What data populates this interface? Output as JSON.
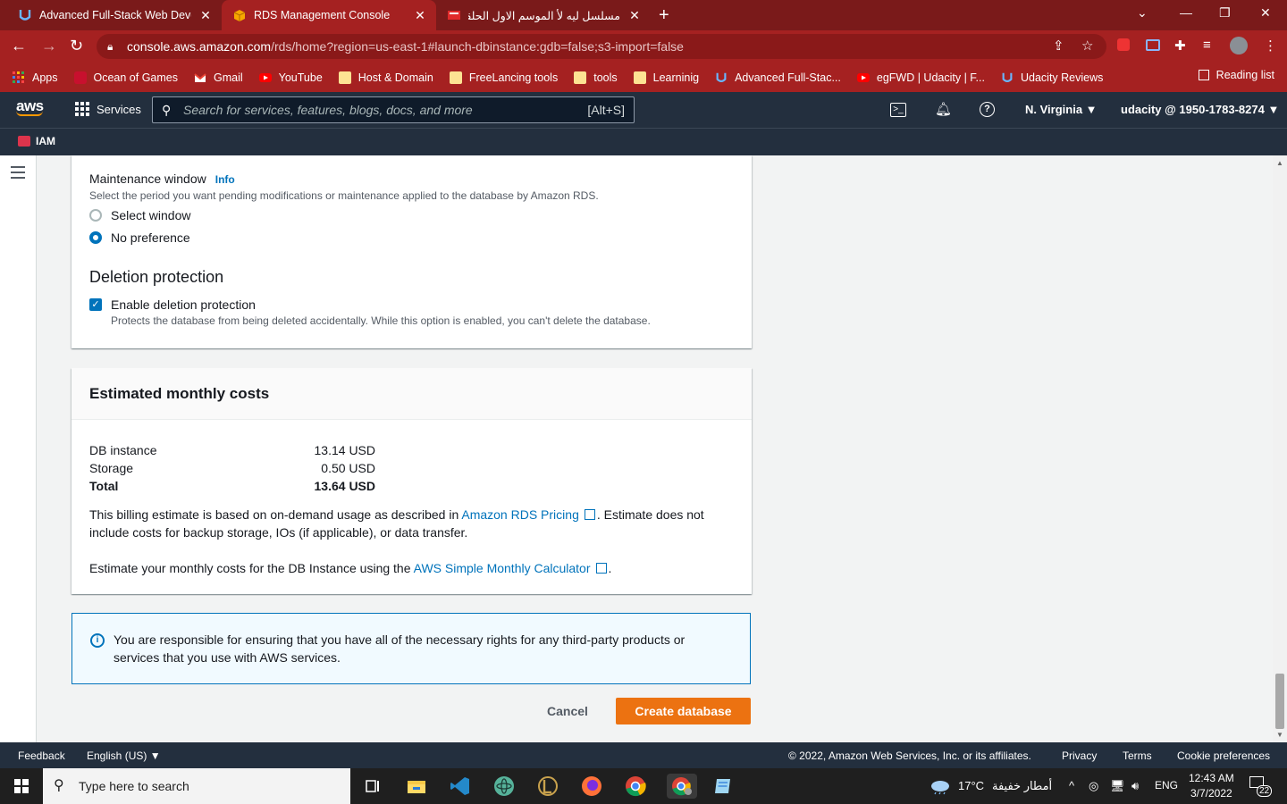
{
  "browser": {
    "tabs": [
      {
        "title": "Advanced Full-Stack Web Develo",
        "close": "✕"
      },
      {
        "title": "RDS Management Console",
        "close": "✕"
      },
      {
        "title": "مسلسل ليه لأ الموسم الاول الحلقة",
        "close": "✕"
      }
    ],
    "url_domain": "console.aws.amazon.com",
    "url_rest": "/rds/home?region=us-east-1#launch-dbinstance:gdb=false;s3-import=false",
    "bookmarks": [
      "Apps",
      "Ocean of Games",
      "Gmail",
      "YouTube",
      "Host & Domain",
      "FreeLancing tools",
      "tools",
      "Learninig",
      "Advanced Full-Stac...",
      "egFWD | Udacity | F...",
      "Udacity Reviews"
    ],
    "reading_list": "Reading list"
  },
  "aws_header": {
    "logo": "aws",
    "services": "Services",
    "search_placeholder": "Search for services, features, blogs, docs, and more",
    "search_shortcut": "[Alt+S]",
    "region": "N. Virginia ▼",
    "account": "udacity @ 1950-1783-8274 ▼",
    "favorite": "IAM"
  },
  "maintenance": {
    "label": "Maintenance window",
    "info": "Info",
    "description": "Select the period you want pending modifications or maintenance applied to the database by Amazon RDS.",
    "options": [
      "Select window",
      "No preference"
    ],
    "selected": "No preference"
  },
  "deletion": {
    "title": "Deletion protection",
    "checkbox_label": "Enable deletion protection",
    "checked": true,
    "description": "Protects the database from being deleted accidentally. While this option is enabled, you can't delete the database."
  },
  "costs": {
    "title": "Estimated monthly costs",
    "rows": [
      {
        "label": "DB instance",
        "value": "13.14 USD"
      },
      {
        "label": "Storage",
        "value": "0.50 USD"
      },
      {
        "label": "Total",
        "value": "13.64 USD"
      }
    ],
    "billing_text_1": "This billing estimate is based on on-demand usage as described in ",
    "billing_link": "Amazon RDS Pricing",
    "billing_text_2": ". Estimate does not include costs for backup storage, IOs (if applicable), or data transfer.",
    "calc_text": "Estimate your monthly costs for the DB Instance using the ",
    "calc_link": "AWS Simple Monthly Calculator",
    "calc_end": "."
  },
  "alert": {
    "text": "You are responsible for ensuring that you have all of the necessary rights for any third-party products or services that you use with AWS services."
  },
  "actions": {
    "cancel": "Cancel",
    "create": "Create database"
  },
  "footer": {
    "feedback": "Feedback",
    "language": "English (US) ▼",
    "copyright": "© 2022, Amazon Web Services, Inc. or its affiliates.",
    "privacy": "Privacy",
    "terms": "Terms",
    "cookies": "Cookie preferences"
  },
  "taskbar": {
    "search_placeholder": "Type here to search",
    "weather": "17°C",
    "weather_desc": "أمطار خفيفة",
    "lang": "ENG",
    "time": "12:43 AM",
    "date": "3/7/2022",
    "notifications": "22"
  },
  "colors": {
    "chrome_frame": "#7a1a1a",
    "chrome_active": "#a52121",
    "aws_nav": "#232f3e",
    "link": "#0073bb",
    "primary_button": "#ec7211"
  }
}
